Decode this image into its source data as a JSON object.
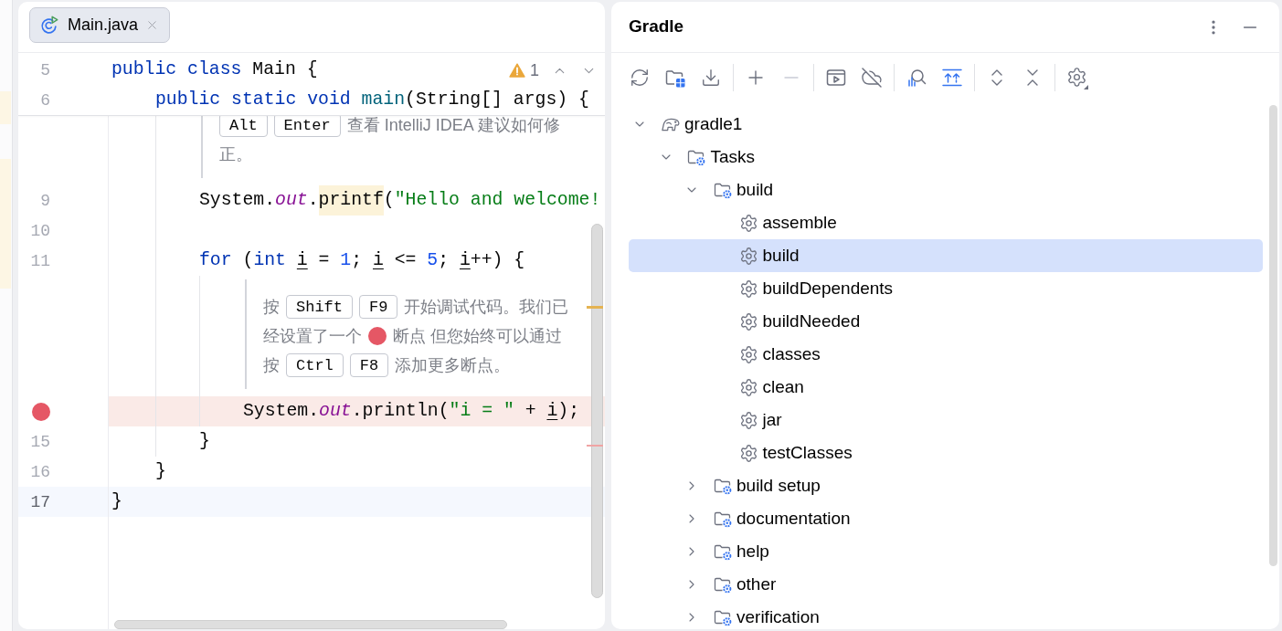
{
  "editor": {
    "tabs": [
      {
        "label": "Main.java",
        "selected": true
      }
    ],
    "inspection": {
      "warnings": "1"
    },
    "lines": [
      {
        "kind": "code",
        "number": "5",
        "sticky": true,
        "current": false,
        "breakpoint": false,
        "tokens": [
          {
            "kind": "keyword",
            "text": "public "
          },
          {
            "kind": "keyword",
            "text": "class "
          },
          {
            "kind": "plain",
            "text": "Main {"
          }
        ],
        "children": [
          {
            "kind": "code",
            "number": "6",
            "sticky": true,
            "current": false,
            "breakpoint": false,
            "tokens": [
              {
                "kind": "keyword",
                "text": "public "
              },
              {
                "kind": "keyword",
                "text": "static "
              },
              {
                "kind": "keyword",
                "text": "void "
              },
              {
                "kind": "declaration",
                "text": "main"
              },
              {
                "kind": "plain",
                "text": "(String[] args) {"
              }
            ],
            "children": [
              {
                "kind": "hint",
                "rows": [
                  {
                    "parts": [
                      {
                        "kind": "key",
                        "text": "Alt"
                      },
                      {
                        "kind": "key",
                        "text": "Enter"
                      },
                      {
                        "kind": "text",
                        "text": "查看 IntelliJ IDEA 建议如何修"
                      }
                    ]
                  },
                  {
                    "parts": [
                      {
                        "kind": "text",
                        "text": "正。"
                      }
                    ]
                  }
                ]
              },
              {
                "kind": "code",
                "number": "9",
                "sticky": false,
                "current": false,
                "breakpoint": false,
                "tokens": [
                  {
                    "kind": "plain",
                    "text": "System."
                  },
                  {
                    "kind": "static_field",
                    "text": "out"
                  },
                  {
                    "kind": "plain",
                    "text": "."
                  },
                  {
                    "kind": "usage",
                    "text": "printf"
                  },
                  {
                    "kind": "plain",
                    "text": "("
                  },
                  {
                    "kind": "string",
                    "text": "\"Hello and welcome!"
                  }
                ]
              },
              {
                "kind": "code",
                "number": "10",
                "sticky": false,
                "current": false,
                "breakpoint": false
              },
              {
                "kind": "code",
                "number": "11",
                "sticky": false,
                "current": false,
                "breakpoint": false,
                "tokens": [
                  {
                    "kind": "keyword",
                    "text": "for"
                  },
                  {
                    "kind": "plain",
                    "text": " ("
                  },
                  {
                    "kind": "keyword",
                    "text": "int "
                  },
                  {
                    "kind": "reassigned",
                    "text": "i"
                  },
                  {
                    "kind": "plain",
                    "text": " = "
                  },
                  {
                    "kind": "number",
                    "text": "1"
                  },
                  {
                    "kind": "plain",
                    "text": "; "
                  },
                  {
                    "kind": "reassigned",
                    "text": "i"
                  },
                  {
                    "kind": "plain",
                    "text": " <= "
                  },
                  {
                    "kind": "number",
                    "text": "5"
                  },
                  {
                    "kind": "plain",
                    "text": "; "
                  },
                  {
                    "kind": "reassigned",
                    "text": "i"
                  },
                  {
                    "kind": "plain",
                    "text": "++) {"
                  }
                ],
                "children": [
                  {
                    "kind": "hint",
                    "rows": [
                      {
                        "parts": [
                          {
                            "kind": "text",
                            "text": "按"
                          },
                          {
                            "kind": "key",
                            "text": "Shift"
                          },
                          {
                            "kind": "key",
                            "text": "F9"
                          },
                          {
                            "kind": "text",
                            "text": "开始调试代码。我们已"
                          }
                        ]
                      },
                      {
                        "parts": [
                          {
                            "kind": "text",
                            "text": "经设置了一个"
                          },
                          {
                            "kind": "breakpoint"
                          },
                          {
                            "kind": "text",
                            "text": "断点 但您始终可以通过"
                          }
                        ]
                      },
                      {
                        "parts": [
                          {
                            "kind": "text",
                            "text": "按"
                          },
                          {
                            "kind": "key",
                            "text": "Ctrl"
                          },
                          {
                            "kind": "key",
                            "text": "F8"
                          },
                          {
                            "kind": "text",
                            "text": "添加更多断点。"
                          }
                        ]
                      }
                    ]
                  },
                  {
                    "kind": "code",
                    "sticky": false,
                    "current": false,
                    "breakpoint": true,
                    "tokens": [
                      {
                        "kind": "plain",
                        "text": "System."
                      },
                      {
                        "kind": "static_field",
                        "text": "out"
                      },
                      {
                        "kind": "plain",
                        "text": ".println("
                      },
                      {
                        "kind": "string",
                        "text": "\"i = \""
                      },
                      {
                        "kind": "plain",
                        "text": " + "
                      },
                      {
                        "kind": "reassigned",
                        "text": "i"
                      },
                      {
                        "kind": "plain",
                        "text": ");"
                      }
                    ]
                  }
                ]
              },
              {
                "kind": "code",
                "number": "15",
                "sticky": false,
                "current": false,
                "breakpoint": false,
                "tokens": [
                  {
                    "kind": "plain",
                    "text": "}"
                  }
                ]
              }
            ]
          },
          {
            "kind": "code",
            "number": "16",
            "sticky": false,
            "current": false,
            "breakpoint": false,
            "tokens": [
              {
                "kind": "plain",
                "text": "}"
              }
            ]
          }
        ]
      },
      {
        "kind": "code",
        "number": "17",
        "sticky": false,
        "current": true,
        "breakpoint": false,
        "tokens": [
          {
            "kind": "plain",
            "text": "}"
          }
        ]
      }
    ]
  },
  "gradle": {
    "title": "Gradle",
    "toolbar": [
      {
        "items": [
          {
            "kind": "reload",
            "disabled": false
          },
          {
            "kind": "link_project",
            "disabled": false
          },
          {
            "kind": "download",
            "disabled": false
          }
        ]
      },
      {
        "items": [
          {
            "kind": "add",
            "disabled": false
          },
          {
            "kind": "remove",
            "disabled": true
          }
        ]
      },
      {
        "items": [
          {
            "kind": "run_task",
            "disabled": false
          },
          {
            "kind": "offline",
            "disabled": false
          }
        ]
      },
      {
        "items": [
          {
            "kind": "analyze",
            "disabled": false
          },
          {
            "kind": "show_dependencies",
            "disabled": false
          }
        ]
      },
      {
        "items": [
          {
            "kind": "expand_all",
            "disabled": false
          },
          {
            "kind": "collapse_all",
            "disabled": false
          }
        ]
      },
      {
        "items": [
          {
            "kind": "settings",
            "disabled": false
          }
        ]
      }
    ],
    "tree": [
      {
        "label": "gradle1",
        "kind": "project",
        "expanded": true,
        "selected": false,
        "children": [
          {
            "label": "Tasks",
            "kind": "group",
            "expanded": true,
            "selected": false,
            "children": [
              {
                "label": "build",
                "kind": "group",
                "expanded": true,
                "selected": false,
                "children": [
                  {
                    "label": "assemble",
                    "kind": "task",
                    "selected": false
                  },
                  {
                    "label": "build",
                    "kind": "task",
                    "selected": true
                  },
                  {
                    "label": "buildDependents",
                    "kind": "task",
                    "selected": false
                  },
                  {
                    "label": "buildNeeded",
                    "kind": "task",
                    "selected": false
                  },
                  {
                    "label": "classes",
                    "kind": "task",
                    "selected": false
                  },
                  {
                    "label": "clean",
                    "kind": "task",
                    "selected": false
                  },
                  {
                    "label": "jar",
                    "kind": "task",
                    "selected": false
                  },
                  {
                    "label": "testClasses",
                    "kind": "task",
                    "selected": false
                  }
                ]
              },
              {
                "label": "build setup",
                "kind": "group",
                "expanded": false,
                "selected": false
              },
              {
                "label": "documentation",
                "kind": "group",
                "expanded": false,
                "selected": false
              },
              {
                "label": "help",
                "kind": "group",
                "expanded": false,
                "selected": false
              },
              {
                "label": "other",
                "kind": "group",
                "expanded": false,
                "selected": false
              },
              {
                "label": "verification",
                "kind": "group",
                "expanded": false,
                "selected": false
              }
            ]
          }
        ]
      }
    ]
  }
}
